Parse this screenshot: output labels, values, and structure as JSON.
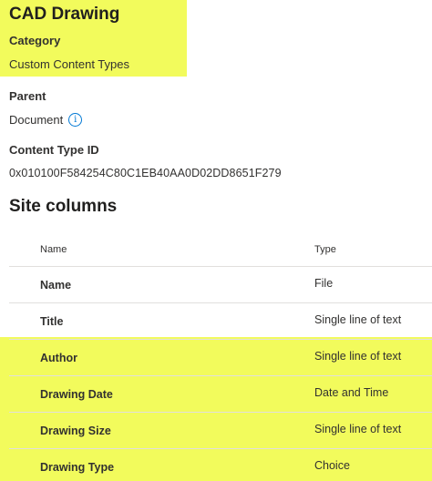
{
  "content_type": {
    "title": "CAD Drawing",
    "category_label": "Category",
    "category_value": "Custom Content Types",
    "parent_label": "Parent",
    "parent_value": "Document",
    "id_label": "Content Type ID",
    "id_value": "0x010100F584254C80C1EB40AA0D02DD8651F279"
  },
  "site_columns": {
    "title": "Site columns",
    "headers": {
      "name": "Name",
      "type": "Type"
    },
    "rows": [
      {
        "name": "Name",
        "type": "File"
      },
      {
        "name": "Title",
        "type": "Single line of text"
      },
      {
        "name": "Author",
        "type": "Single line of text"
      },
      {
        "name": "Drawing Date",
        "type": "Date and Time"
      },
      {
        "name": "Drawing Size",
        "type": "Single line of text"
      },
      {
        "name": "Drawing Type",
        "type": "Choice"
      }
    ]
  },
  "colors": {
    "highlight": "#f2fb5c",
    "info_icon": "#0078d4"
  },
  "icons": {
    "parent_info": "info-icon"
  }
}
